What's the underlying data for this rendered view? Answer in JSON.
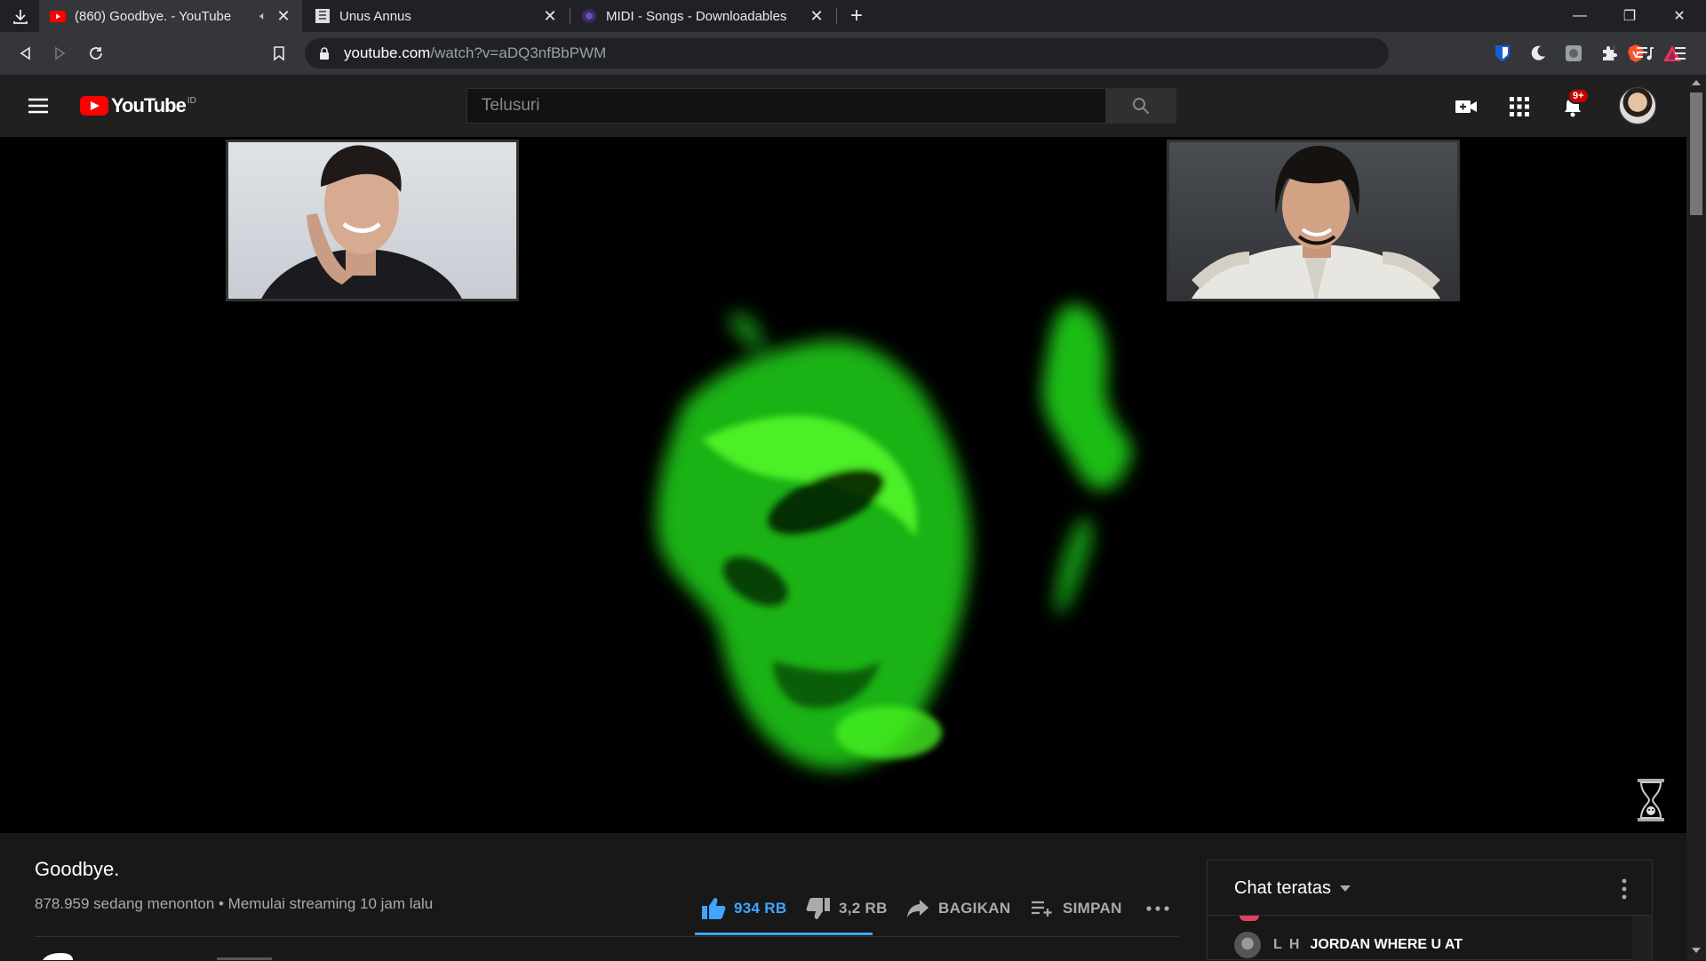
{
  "browser": {
    "tabs": [
      {
        "title": "(860) Goodbye. - YouTube",
        "active": true,
        "muted_icon": "speaker-icon"
      },
      {
        "title": "Unus Annus",
        "active": false
      },
      {
        "title": "MIDI - Songs - Downloadables",
        "active": false
      }
    ],
    "url_host": "youtube.com",
    "url_path": "/watch?v=aDQ3nfBbPWM"
  },
  "masthead": {
    "logo_text": "YouTube",
    "country_code": "ID",
    "search_placeholder": "Telusuri",
    "notification_count": "9+"
  },
  "video": {
    "title": "Goodbye.",
    "meta": "878.959 sedang menonton • Memulai streaming 10 jam lalu",
    "like_count": "934 RB",
    "dislike_count": "3,2 RB",
    "share_label": "BAGIKAN",
    "save_label": "SIMPAN",
    "like_ratio": 0.997
  },
  "chat": {
    "mode_label": "Chat teratas",
    "messages": [
      {
        "author": "L H",
        "text": "JORDAN WHERE U AT"
      }
    ]
  },
  "colors": {
    "youtube_red": "#ff0000",
    "like_blue": "#3ea6ff",
    "ghost_green": "#39ff14"
  }
}
